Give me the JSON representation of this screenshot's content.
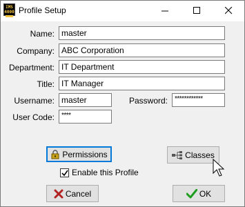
{
  "window": {
    "title": "Profile Setup",
    "app_icon_text": "IMS 4000",
    "minimize": "minimize-icon",
    "maximize": "maximize-icon",
    "close": "close-icon"
  },
  "form": {
    "name": {
      "label": "Name:",
      "value": "master"
    },
    "company": {
      "label": "Company:",
      "value": "ABC Corporation"
    },
    "department": {
      "label": "Department:",
      "value": "IT Department"
    },
    "title": {
      "label": "Title:",
      "value": "IT Manager"
    },
    "username": {
      "label": "Username:",
      "value": "master"
    },
    "password": {
      "label": "Password:",
      "value": "************"
    },
    "usercode": {
      "label": "User Code:",
      "value": "****"
    }
  },
  "buttons": {
    "permissions": "Permissions",
    "classes": "Classes",
    "cancel": "Cancel",
    "ok": "OK"
  },
  "checkbox": {
    "label": "Enable this Profile",
    "checked": true
  },
  "colors": {
    "accent": "#0078d7",
    "cancel_icon": "#b22222",
    "ok_icon": "#1e9e1e"
  }
}
